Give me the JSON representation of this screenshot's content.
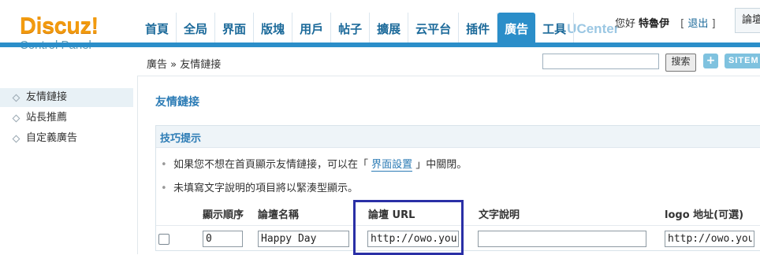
{
  "brand": {
    "name": "Discuz!",
    "subtitle": "Control Panel"
  },
  "nav": {
    "tabs": [
      {
        "label": "首頁",
        "active": false
      },
      {
        "label": "全局",
        "active": false
      },
      {
        "label": "界面",
        "active": false
      },
      {
        "label": "版塊",
        "active": false
      },
      {
        "label": "用戶",
        "active": false
      },
      {
        "label": "帖子",
        "active": false
      },
      {
        "label": "擴展",
        "active": false
      },
      {
        "label": "云平台",
        "active": false
      },
      {
        "label": "插件",
        "active": false
      },
      {
        "label": "廣告",
        "active": true
      },
      {
        "label": "工具",
        "active": false
      },
      {
        "label": "UCenter",
        "active": false
      }
    ],
    "accent_color": "#2b8ec9"
  },
  "user": {
    "greeting": "您好",
    "name": "特魯伊",
    "logout_label": "退出",
    "bracket_left": "[",
    "bracket_right": "]",
    "forum_link": "論壇"
  },
  "subbar": {
    "breadcrumb": "廣告 » 友情鏈接",
    "search_value": "",
    "search_button": "搜索",
    "plus_label": "+",
    "sitemap_label": "SITEM"
  },
  "sidebar": {
    "items": [
      {
        "label": "友情鏈接",
        "active": true
      },
      {
        "label": "站長推薦",
        "active": false
      },
      {
        "label": "自定義廣告",
        "active": false
      }
    ]
  },
  "main": {
    "title": "友情鏈接",
    "tips": {
      "heading": "技巧提示",
      "items": [
        {
          "prefix": "如果您不想在首頁顯示友情鏈接，可以在「 ",
          "link": "界面設置",
          "suffix": " 」中關閉。"
        },
        {
          "text": "未填寫文字說明的項目將以緊湊型顯示。"
        }
      ]
    },
    "table": {
      "headers": [
        "顯示順序",
        "論壇名稱",
        "論壇 URL",
        "文字說明",
        "logo 地址(可選)"
      ],
      "rows": [
        {
          "checked": false,
          "order": "0",
          "name": "Happy Day",
          "url": "http://owo.youp",
          "description": "",
          "logo": "http://owo.youp"
        }
      ]
    }
  }
}
